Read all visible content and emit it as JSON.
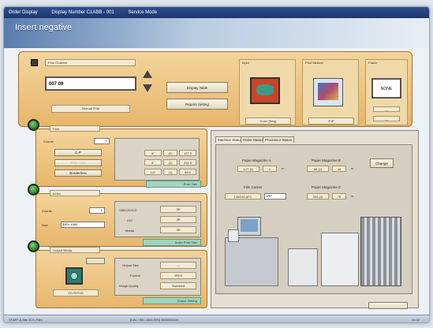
{
  "titlebar": {
    "items": [
      "Order Display",
      "Display Number C1ABB - 001",
      "Service Mode"
    ]
  },
  "header": {
    "title": "Insert negative"
  },
  "top": {
    "print_channel_label": "Print Channel",
    "channel_value": "007 09",
    "channel_sub": "Normal Print",
    "display_table": "Display Table",
    "reprint_setting": "Reprint Setting"
  },
  "cards": [
    {
      "title": "Input",
      "caption": "Color (Neg)"
    },
    {
      "title": "Print Method",
      "caption": "PJP"
    },
    {
      "title": "Frame",
      "value": "NONE",
      "small1": "---",
      "small2": "---"
    }
  ],
  "print": {
    "tab": "Print",
    "counts_label": "Counts",
    "counts_value": "1",
    "options": [
      "C-P",
      "Print Size",
      "Borderless"
    ],
    "rows": [
      [
        "8\"",
        "(2)",
        "127.0"
      ],
      [
        "8\"",
        "(2)",
        "254.0"
      ],
      [
        "127",
        "(1)",
        "89.0"
      ]
    ],
    "footer": "Print Size"
  },
  "index": {
    "tab": "Index",
    "counts_label": "Counts",
    "counts_value": "1",
    "size_label": "Size",
    "size_value": "IDEX 1000",
    "left_vals": [
      "136/120/110",
      "240",
      "Media"
    ],
    "right_vals": [
      "3R",
      "3R",
      "3R"
    ],
    "footer": "Index Print Size"
  },
  "output": {
    "tab": "Output Media",
    "media_name": "CD-R/DVD",
    "labels": [
      "Output Size",
      "Format",
      "Image Quality"
    ],
    "values": [
      "---",
      "JPEG",
      "Standard"
    ],
    "footer": "Output Setting"
  },
  "status": {
    "tabs": [
      "Machine Status",
      "Order Status",
      "Processor Status"
    ],
    "magazine_a": {
      "label": "Paper Magazine A",
      "v1": "127 (1)",
      "v2": "0",
      "unit": "m"
    },
    "magazine_b": {
      "label": "Paper Magazine B",
      "v1": "89 (2)",
      "v2": "45",
      "unit": "m"
    },
    "film_carrier": {
      "label": "Film Carrier",
      "v1": "135/240 AFC",
      "v2": "1RP"
    },
    "magazine_c": {
      "label": "Paper Magazine C",
      "v1": "305 (2)",
      "v2": "75",
      "unit": "m"
    },
    "change": "Change"
  },
  "taskbar": {
    "left": "START  A  Sim  4Cm  Fdm",
    "mid": "[CALJ 001-1000-000]  0000000000",
    "time": "11:02"
  },
  "colors": {
    "accent_orange": "#e7b66c",
    "title_blue": "#1d3670",
    "status_green": "#2c8a2f"
  }
}
